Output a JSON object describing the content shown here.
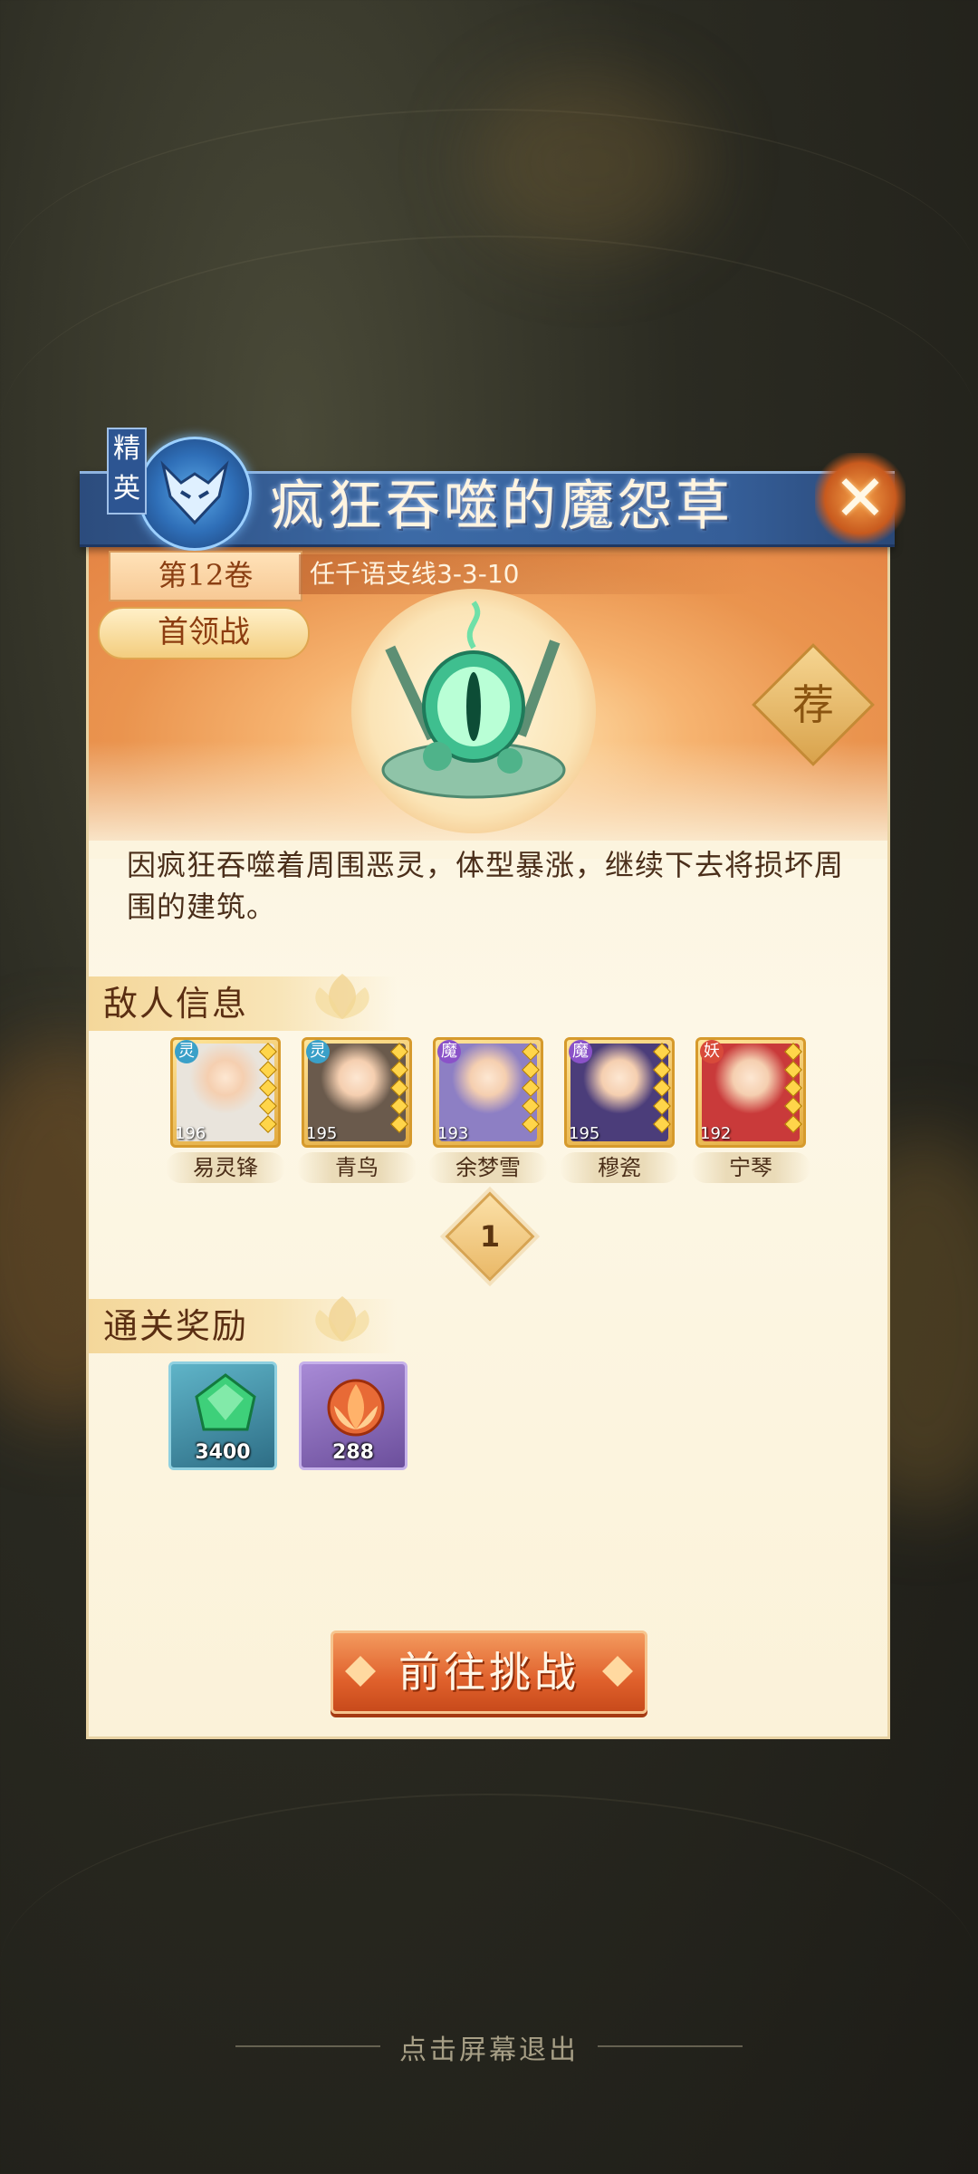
{
  "header": {
    "elite_tag": "精英",
    "title": "疯狂吞噬的魔怨草"
  },
  "stage": {
    "volume": "第12卷",
    "path": "任千语支线3-3-10",
    "battle_type": "首领战",
    "recommend_badge": "荐",
    "description": "因疯狂吞噬着周围恶灵，体型暴涨，继续下去将损坏周围的建筑。"
  },
  "enemies": {
    "section_title": "敌人信息",
    "list": [
      {
        "name": "易灵锋",
        "level": "196",
        "type": "灵",
        "type_color": "#3aa0c8",
        "bg": "#e9e4dc"
      },
      {
        "name": "青鸟",
        "level": "195",
        "type": "灵",
        "type_color": "#3aa0c8",
        "bg": "#6a5a4c"
      },
      {
        "name": "余梦雪",
        "level": "193",
        "type": "魔",
        "type_color": "#8a52c8",
        "bg": "#8d7fc4"
      },
      {
        "name": "穆瓷",
        "level": "195",
        "type": "魔",
        "type_color": "#8a52c8",
        "bg": "#4b3d7a"
      },
      {
        "name": "宁琴",
        "level": "192",
        "type": "妖",
        "type_color": "#d84a3a",
        "bg": "#c93a3a"
      }
    ],
    "page": "1"
  },
  "rewards": {
    "section_title": "通关奖励",
    "items": [
      {
        "icon": "green-jade-icon",
        "count": "3400",
        "frame": "#3f8fa8"
      },
      {
        "icon": "fire-lotus-icon",
        "count": "288",
        "frame": "#8a68b8"
      }
    ]
  },
  "actions": {
    "challenge_label": "前往挑战",
    "exit_hint": "点击屏幕退出"
  }
}
